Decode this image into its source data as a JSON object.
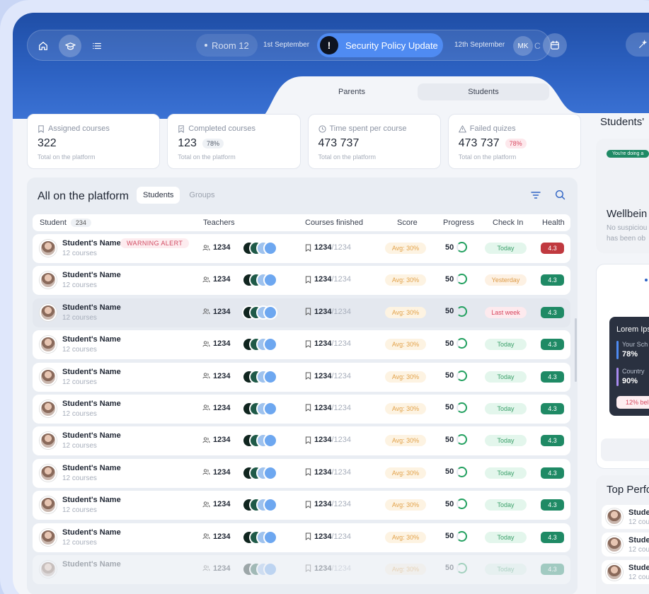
{
  "topbar": {
    "room": "Room 12",
    "date_left": "1st September",
    "update_label": "Security Policy Update",
    "update_icon": "!",
    "date_right": "12th September",
    "avatar_initials": "MK",
    "avatar_ghost": "C"
  },
  "segment": {
    "tabs": [
      "Parents",
      "Students"
    ],
    "active": "Students"
  },
  "stats": [
    {
      "title": "Assigned courses",
      "value": "322",
      "pct": "",
      "sub": "Total on the platform",
      "icon": "bookmark-icon"
    },
    {
      "title": "Completed courses",
      "value": "123",
      "pct": "78%",
      "sub": "Total on the platform",
      "icon": "bookmark-check-icon"
    },
    {
      "title": "Time spent per course",
      "value": "473 737",
      "pct": "",
      "sub": "Total on the platform",
      "icon": "clock-icon"
    },
    {
      "title": "Failed quizes",
      "value": "473 737",
      "pct": "78%",
      "sub": "Total on the platform",
      "icon": "warning-icon"
    }
  ],
  "panel": {
    "title": "All on the platform",
    "tabs": [
      "Students",
      "Groups"
    ],
    "headers": {
      "student": "Student",
      "count": "234",
      "teachers": "Teachers",
      "courses": "Courses finished",
      "score": "Score",
      "progress": "Progress",
      "checkin": "Check In",
      "health": "Health"
    },
    "rows": [
      {
        "name": "Student's Name",
        "sub": "12 courses",
        "alert": "WARNING ALERT",
        "teachers": "1234",
        "done": "1234",
        "total": "/1234",
        "score": "Avg: 30%",
        "progress": "50",
        "checkin": "Today",
        "checkin_tone": "green",
        "health": "4.3",
        "health_tone": "red"
      },
      {
        "name": "Student's Name",
        "sub": "12 courses",
        "alert": "",
        "teachers": "1234",
        "done": "1234",
        "total": "/1234",
        "score": "Avg: 30%",
        "progress": "50",
        "checkin": "Yesterday",
        "checkin_tone": "orange",
        "health": "4.3",
        "health_tone": "green"
      },
      {
        "name": "Student's Name",
        "sub": "12 courses",
        "alert": "",
        "teachers": "1234",
        "done": "1234",
        "total": "/1234",
        "score": "Avg: 30%",
        "progress": "50",
        "checkin": "Last week",
        "checkin_tone": "red",
        "health": "4.3",
        "health_tone": "green"
      },
      {
        "name": "Student's Name",
        "sub": "12 courses",
        "alert": "",
        "teachers": "1234",
        "done": "1234",
        "total": "/1234",
        "score": "Avg: 30%",
        "progress": "50",
        "checkin": "Today",
        "checkin_tone": "green",
        "health": "4.3",
        "health_tone": "green"
      },
      {
        "name": "Student's Name",
        "sub": "12 courses",
        "alert": "",
        "teachers": "1234",
        "done": "1234",
        "total": "/1234",
        "score": "Avg: 30%",
        "progress": "50",
        "checkin": "Today",
        "checkin_tone": "green",
        "health": "4.3",
        "health_tone": "green"
      },
      {
        "name": "Student's Name",
        "sub": "12 courses",
        "alert": "",
        "teachers": "1234",
        "done": "1234",
        "total": "/1234",
        "score": "Avg: 30%",
        "progress": "50",
        "checkin": "Today",
        "checkin_tone": "green",
        "health": "4.3",
        "health_tone": "green"
      },
      {
        "name": "Student's Name",
        "sub": "12 courses",
        "alert": "",
        "teachers": "1234",
        "done": "1234",
        "total": "/1234",
        "score": "Avg: 30%",
        "progress": "50",
        "checkin": "Today",
        "checkin_tone": "green",
        "health": "4.3",
        "health_tone": "green"
      },
      {
        "name": "Student's Name",
        "sub": "12 courses",
        "alert": "",
        "teachers": "1234",
        "done": "1234",
        "total": "/1234",
        "score": "Avg: 30%",
        "progress": "50",
        "checkin": "Today",
        "checkin_tone": "green",
        "health": "4.3",
        "health_tone": "green"
      },
      {
        "name": "Student's Name",
        "sub": "12 courses",
        "alert": "",
        "teachers": "1234",
        "done": "1234",
        "total": "/1234",
        "score": "Avg: 30%",
        "progress": "50",
        "checkin": "Today",
        "checkin_tone": "green",
        "health": "4.3",
        "health_tone": "green"
      },
      {
        "name": "Student's Name",
        "sub": "12 courses",
        "alert": "",
        "teachers": "1234",
        "done": "1234",
        "total": "/1234",
        "score": "Avg: 30%",
        "progress": "50",
        "checkin": "Today",
        "checkin_tone": "green",
        "health": "4.3",
        "health_tone": "green"
      },
      {
        "name": "Student's Name",
        "sub": "",
        "alert": "",
        "teachers": "1234",
        "done": "1234",
        "total": "/1234",
        "score": "Avg: 30%",
        "progress": "50",
        "checkin": "Today",
        "checkin_tone": "green",
        "health": "4.3",
        "health_tone": "green"
      }
    ]
  },
  "right": {
    "title": "Students'",
    "badge": "You're doing a",
    "wellbeing_title": "Wellbein",
    "wellbeing_text": [
      "No suspiciou",
      "has been ob"
    ],
    "tooltip": {
      "title": "Lorem Ips",
      "items": [
        {
          "label": "Your Sch",
          "value": "78%"
        },
        {
          "label": "Country",
          "value": "90%"
        }
      ],
      "button": "12% bel"
    },
    "top_title": "Top Perfo",
    "top_rows": [
      {
        "name": "Stude",
        "sub": "12 cou"
      },
      {
        "name": "Stude",
        "sub": "12 cou"
      },
      {
        "name": "Stude",
        "sub": "12 cou"
      }
    ]
  },
  "colors": {
    "accent": "#2e63c4",
    "health_green": "#1f8a65",
    "health_red": "#c0393f",
    "alert_red": "#d14a61"
  }
}
